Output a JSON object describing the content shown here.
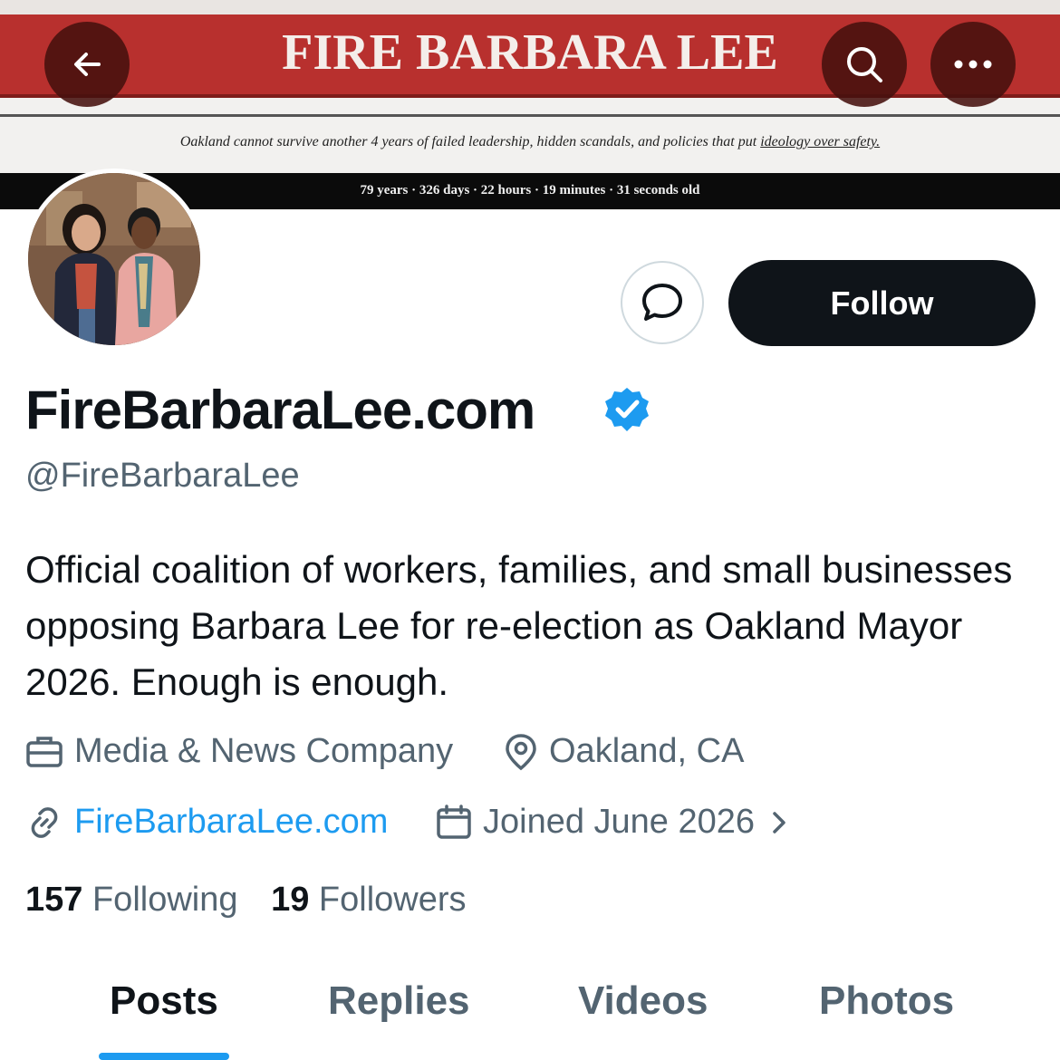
{
  "banner": {
    "title": "FIRE BARBARA LEE",
    "tagline_prefix": "Oakland cannot survive another 4 years of failed leadership, hidden scandals, and policies that put ",
    "tagline_underlined": "ideology over safety.",
    "age_line": "79 years · 326 days · 22 hours · 19 minutes · 31 seconds old",
    "colors": {
      "red": "#b8302e",
      "black": "#0b0b0b"
    }
  },
  "nav": {
    "back_icon": "arrow-left-icon",
    "search_icon": "search-icon",
    "more_icon": "more-horizontal-icon"
  },
  "profile": {
    "display_name": "FireBarbaraLee.com",
    "verified_icon": "verified-badge-icon",
    "handle": "@FireBarbaraLee",
    "bio": "Official coalition of workers, families, and small businesses opposing Barbara Lee for re-election as Oakland Mayor 2026. Enough is enough.",
    "category": "Media & News Company",
    "location": "Oakland, CA",
    "website": "FireBarbaraLee.com",
    "joined": "Joined June 2026",
    "following_count": "157",
    "following_label": "Following",
    "followers_count": "19",
    "followers_label": "Followers"
  },
  "actions": {
    "message_icon": "message-bubble-icon",
    "follow_label": "Follow"
  },
  "tabs": [
    {
      "label": "Posts",
      "active": true
    },
    {
      "label": "Replies",
      "active": false
    },
    {
      "label": "Videos",
      "active": false
    },
    {
      "label": "Photos",
      "active": false
    }
  ],
  "colors": {
    "accent": "#1d9bf0",
    "text": "#0f1419",
    "secondary": "#536471"
  }
}
